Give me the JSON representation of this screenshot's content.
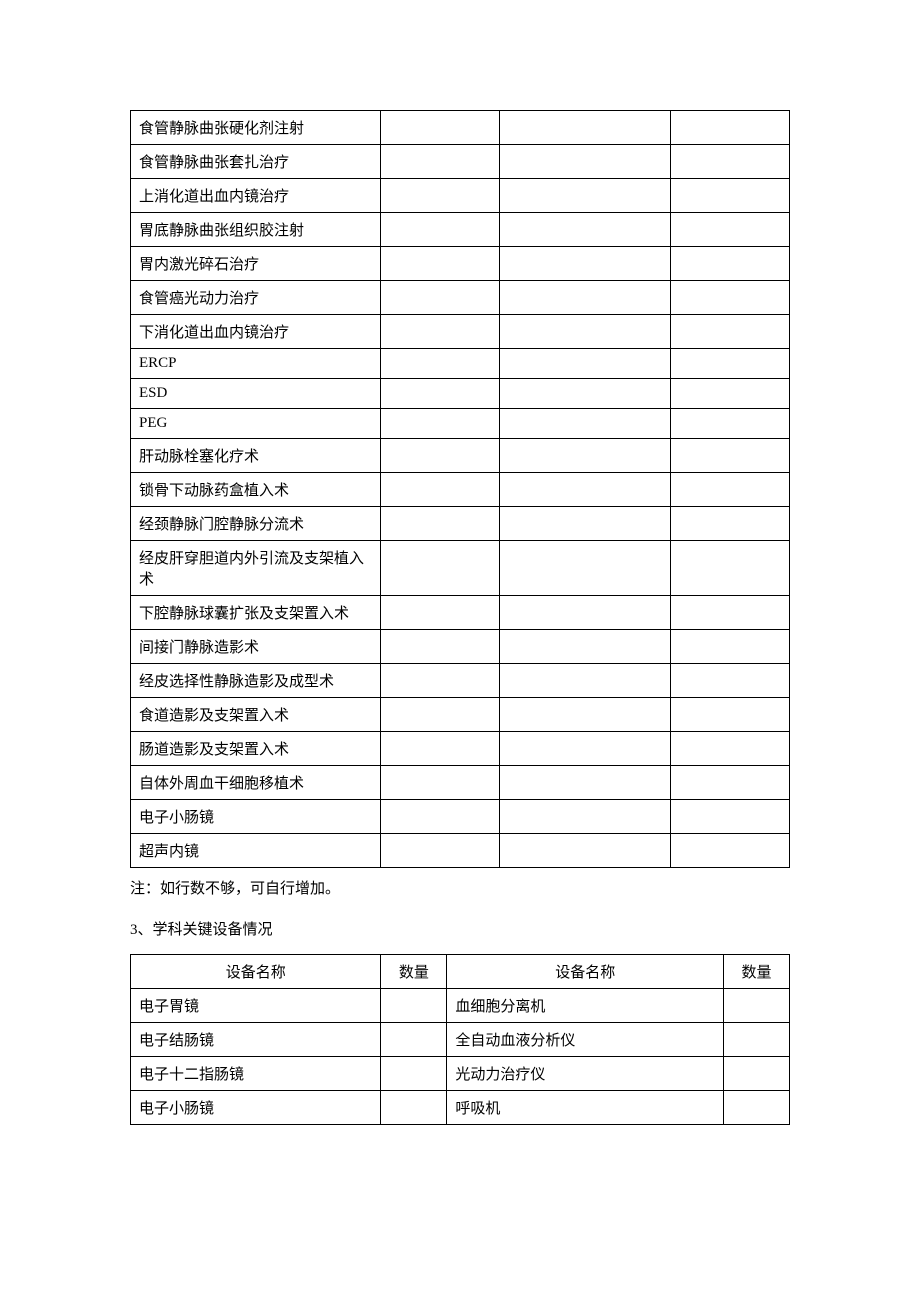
{
  "table1": {
    "rows": [
      {
        "name": "食管静脉曲张硬化剂注射",
        "c2": "",
        "c3": "",
        "c4": ""
      },
      {
        "name": "食管静脉曲张套扎治疗",
        "c2": "",
        "c3": "",
        "c4": ""
      },
      {
        "name": "上消化道出血内镜治疗",
        "c2": "",
        "c3": "",
        "c4": ""
      },
      {
        "name": "胃底静脉曲张组织胶注射",
        "c2": "",
        "c3": "",
        "c4": ""
      },
      {
        "name": "胃内激光碎石治疗",
        "c2": "",
        "c3": "",
        "c4": ""
      },
      {
        "name": "食管癌光动力治疗",
        "c2": "",
        "c3": "",
        "c4": ""
      },
      {
        "name": "下消化道出血内镜治疗",
        "c2": "",
        "c3": "",
        "c4": ""
      },
      {
        "name": "ERCP",
        "c2": "",
        "c3": "",
        "c4": ""
      },
      {
        "name": "ESD",
        "c2": "",
        "c3": "",
        "c4": ""
      },
      {
        "name": "PEG",
        "c2": "",
        "c3": "",
        "c4": ""
      },
      {
        "name": "肝动脉栓塞化疗术",
        "c2": "",
        "c3": "",
        "c4": ""
      },
      {
        "name": "锁骨下动脉药盒植入术",
        "c2": "",
        "c3": "",
        "c4": ""
      },
      {
        "name": "经颈静脉门腔静脉分流术",
        "c2": "",
        "c3": "",
        "c4": ""
      },
      {
        "name": "经皮肝穿胆道内外引流及支架植入术",
        "c2": "",
        "c3": "",
        "c4": ""
      },
      {
        "name": "下腔静脉球囊扩张及支架置入术",
        "c2": "",
        "c3": "",
        "c4": ""
      },
      {
        "name": "间接门静脉造影术",
        "c2": "",
        "c3": "",
        "c4": ""
      },
      {
        "name": "经皮选择性静脉造影及成型术",
        "c2": "",
        "c3": "",
        "c4": ""
      },
      {
        "name": "食道造影及支架置入术",
        "c2": "",
        "c3": "",
        "c4": ""
      },
      {
        "name": "肠道造影及支架置入术",
        "c2": "",
        "c3": "",
        "c4": ""
      },
      {
        "name": "自体外周血干细胞移植术",
        "c2": "",
        "c3": "",
        "c4": ""
      },
      {
        "name": "电子小肠镜",
        "c2": "",
        "c3": "",
        "c4": ""
      },
      {
        "name": "超声内镜",
        "c2": "",
        "c3": "",
        "c4": ""
      }
    ]
  },
  "note_text": "注：如行数不够，可自行增加。",
  "section3_title": "3、学科关键设备情况",
  "table2": {
    "headers": {
      "h1": "设备名称",
      "h2": "数量",
      "h3": "设备名称",
      "h4": "数量"
    },
    "rows": [
      {
        "name1": "电子胃镜",
        "qty1": "",
        "name2": "血细胞分离机",
        "qty2": ""
      },
      {
        "name1": "电子结肠镜",
        "qty1": "",
        "name2": "全自动血液分析仪",
        "qty2": ""
      },
      {
        "name1": "电子十二指肠镜",
        "qty1": "",
        "name2": "光动力治疗仪",
        "qty2": ""
      },
      {
        "name1": "电子小肠镜",
        "qty1": "",
        "name2": "呼吸机",
        "qty2": ""
      }
    ]
  }
}
